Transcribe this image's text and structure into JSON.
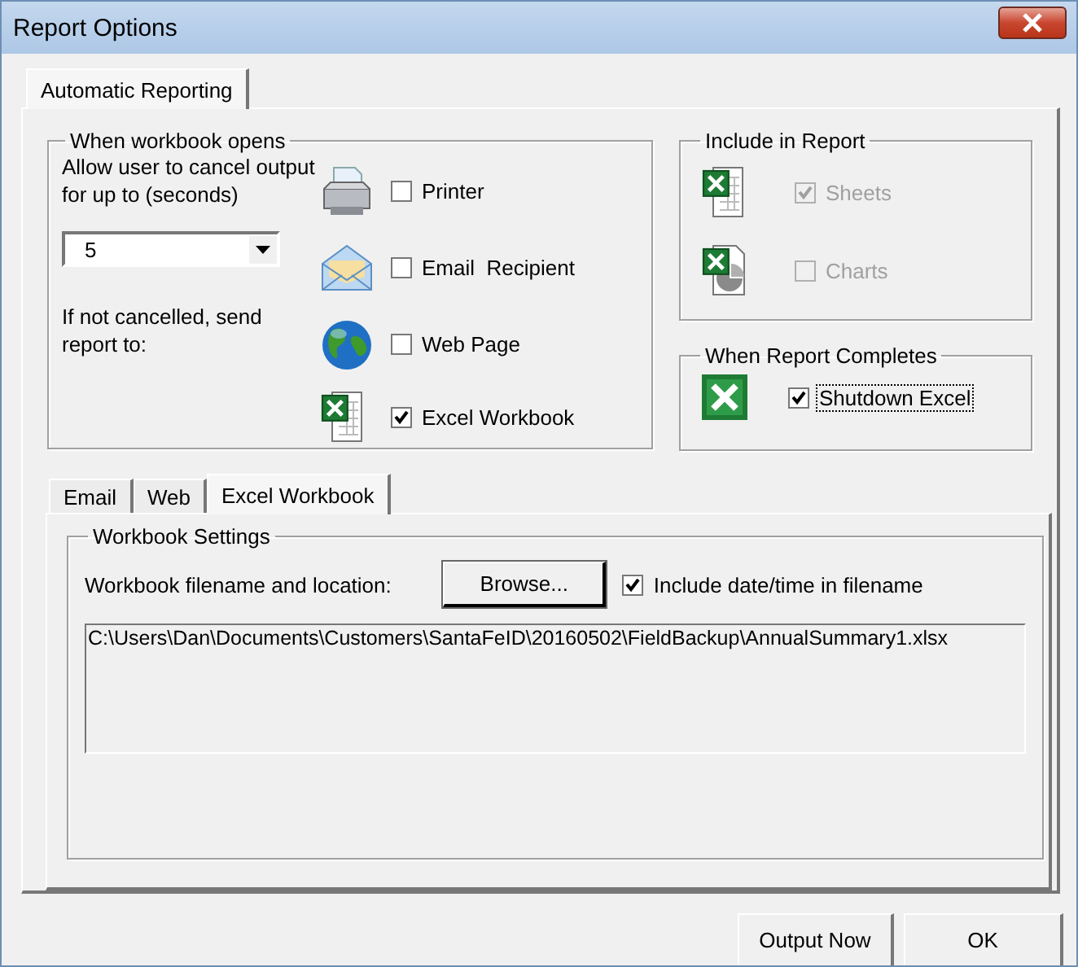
{
  "window": {
    "title": "Report Options"
  },
  "tabs": [
    {
      "label": "Automatic Reporting",
      "selected": true
    }
  ],
  "when_workbook_opens": {
    "title": "When workbook opens",
    "cancel_label": "Allow user to cancel output for up to (seconds)",
    "cancel_seconds": "5",
    "send_label": "If not cancelled, send report to:",
    "destinations": [
      {
        "label": "Printer",
        "checked": false,
        "kind": "printer"
      },
      {
        "label": "Email  Recipient",
        "checked": false,
        "kind": "email"
      },
      {
        "label": "Web Page",
        "checked": false,
        "kind": "web"
      },
      {
        "label": "Excel Workbook",
        "checked": true,
        "kind": "workbook"
      }
    ]
  },
  "include_in_report": {
    "title": "Include in Report",
    "items": [
      {
        "label": "Sheets",
        "checked": true,
        "disabled": true,
        "kind": "sheets"
      },
      {
        "label": "Charts",
        "checked": false,
        "disabled": true,
        "kind": "charts"
      }
    ]
  },
  "when_report_completes": {
    "title": "When Report Completes",
    "items": [
      {
        "label": "Shutdown Excel",
        "checked": true,
        "focused": true,
        "kind": "excel"
      }
    ]
  },
  "output_tabs": [
    {
      "label": "Email",
      "selected": false
    },
    {
      "label": "Web",
      "selected": false
    },
    {
      "label": "Excel Workbook",
      "selected": true
    }
  ],
  "workbook_settings": {
    "title": "Workbook Settings",
    "filename_label": "Workbook filename and location:",
    "browse_button": "Browse...",
    "include_datetime": {
      "label": "Include date/time in filename",
      "checked": true
    },
    "path": "C:\\Users\\Dan\\Documents\\Customers\\SantaFeID\\20160502\\FieldBackup\\AnnualSummary1.xlsx"
  },
  "buttons": [
    "Output Now",
    "OK"
  ]
}
